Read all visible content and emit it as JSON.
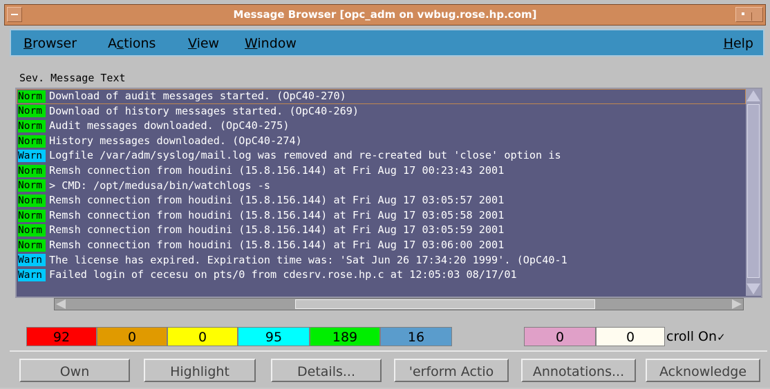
{
  "window": {
    "title": "Message Browser  [opc_adm on vwbug.rose.hp.com]"
  },
  "menu": {
    "browser": {
      "mnemonic": "B",
      "rest": "rowser"
    },
    "actions": {
      "pre": "A",
      "mnemonic": "c",
      "rest": "tions"
    },
    "view": {
      "mnemonic": "V",
      "rest": "iew"
    },
    "window": {
      "mnemonic": "W",
      "rest": "indow"
    },
    "help": {
      "mnemonic": "H",
      "rest": "elp"
    }
  },
  "list": {
    "header": "Sev. Message Text",
    "rows": [
      {
        "sev": "Norm",
        "text": "Download of audit messages started. (OpC40-270)"
      },
      {
        "sev": "Norm",
        "text": "Download of history messages started. (OpC40-269)"
      },
      {
        "sev": "Norm",
        "text": "Audit messages downloaded. (OpC40-275)"
      },
      {
        "sev": "Norm",
        "text": "History messages downloaded. (OpC40-274)"
      },
      {
        "sev": "Warn",
        "text": "Logfile /var/adm/syslog/mail.log was removed and re-created but 'close' option is"
      },
      {
        "sev": "Norm",
        "text": "Remsh connection from houdini (15.8.156.144) at Fri Aug 17 00:23:43 2001"
      },
      {
        "sev": "Norm",
        "text": ">  CMD: /opt/medusa/bin/watchlogs -s"
      },
      {
        "sev": "Norm",
        "text": "Remsh connection from houdini (15.8.156.144) at Fri Aug 17 03:05:57 2001"
      },
      {
        "sev": "Norm",
        "text": "Remsh connection from houdini (15.8.156.144) at Fri Aug 17 03:05:58 2001"
      },
      {
        "sev": "Norm",
        "text": "Remsh connection from houdini (15.8.156.144) at Fri Aug 17 03:05:59 2001"
      },
      {
        "sev": "Norm",
        "text": "Remsh connection from houdini (15.8.156.144) at Fri Aug 17 03:06:00 2001"
      },
      {
        "sev": "Warn",
        "text": "The license has expired. Expiration time was: 'Sat Jun 26 17:34:20 1999'. (OpC40-1"
      },
      {
        "sev": "Warn",
        "text": "Failed login of cecesu on pts/0 from cdesrv.rose.hp.c at 12:05:03 08/17/01"
      }
    ]
  },
  "counters": [
    {
      "value": "92",
      "color": "#ff0000"
    },
    {
      "value": "0",
      "color": "#e09a00"
    },
    {
      "value": "0",
      "color": "#ffff00"
    },
    {
      "value": "95",
      "color": "#00ffff"
    },
    {
      "value": "189",
      "color": "#00ee00"
    },
    {
      "value": "16",
      "color": "#5a9ccc"
    },
    {
      "value": "0",
      "color": "#e0a0c8"
    },
    {
      "value": "0",
      "color": "#fffcf0"
    }
  ],
  "scroll_label": "croll On",
  "buttons": {
    "own": "Own",
    "highlight": "Highlight",
    "details": "Details...",
    "perform": "'erform Actio",
    "annotations": "Annotations...",
    "acknowledge": "Acknowledge"
  }
}
